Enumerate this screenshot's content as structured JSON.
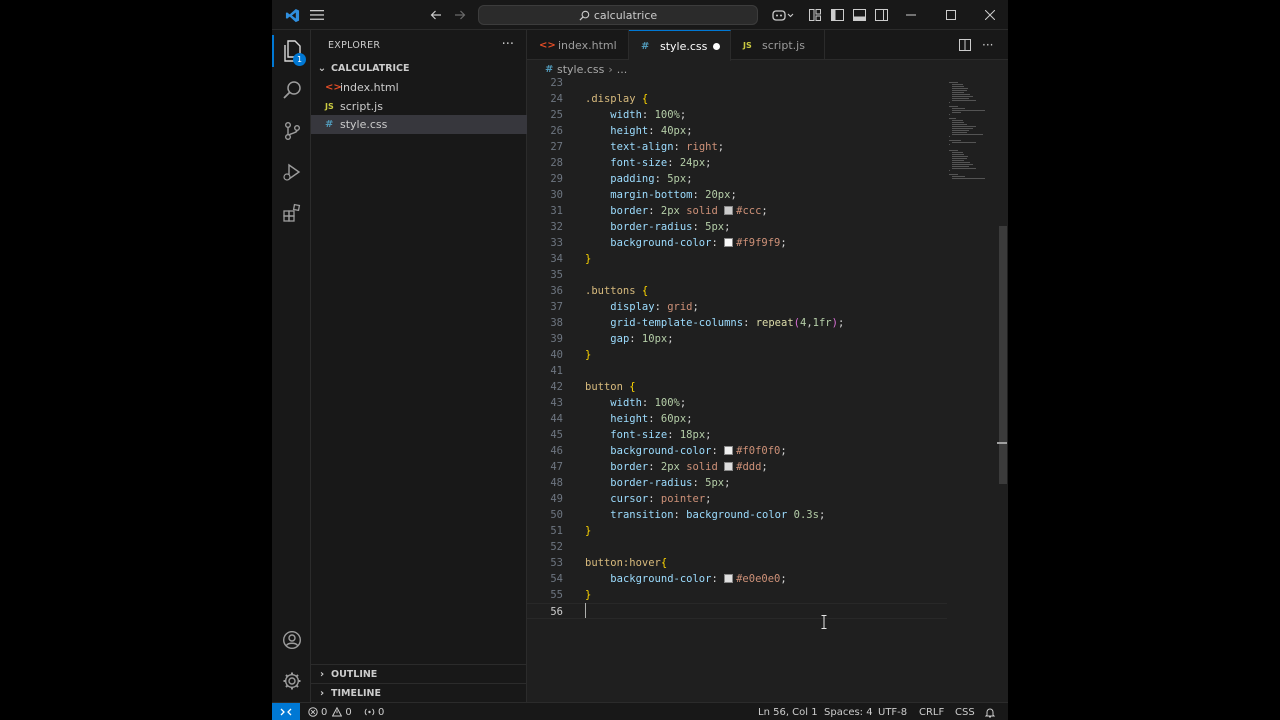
{
  "titlebar": {
    "search_text": "calculatrice"
  },
  "activity": {
    "explorer_badge": "1"
  },
  "sidebar": {
    "header": "EXPLORER",
    "folder": "CALCULATRICE",
    "files": [
      {
        "name": "index.html",
        "type": "html",
        "icon": "<>"
      },
      {
        "name": "script.js",
        "type": "js",
        "icon": "JS"
      },
      {
        "name": "style.css",
        "type": "css",
        "icon": "#"
      }
    ],
    "outline": "OUTLINE",
    "timeline": "TIMELINE"
  },
  "tabs": [
    {
      "label": "index.html",
      "icon": "<>"
    },
    {
      "label": "style.css",
      "icon": "#"
    },
    {
      "label": "script.js",
      "icon": "JS"
    }
  ],
  "breadcrumb": {
    "file": "style.css",
    "icon": "#",
    "more": "..."
  },
  "code": {
    "lines": [
      {
        "n": "23",
        "t": ""
      },
      {
        "n": "24",
        "t": ".display {"
      },
      {
        "n": "25",
        "t": "    width: 100%;"
      },
      {
        "n": "26",
        "t": "    height: 40px;"
      },
      {
        "n": "27",
        "t": "    text-align: right;"
      },
      {
        "n": "28",
        "t": "    font-size: 24px;"
      },
      {
        "n": "29",
        "t": "    padding: 5px;"
      },
      {
        "n": "30",
        "t": "    margin-bottom: 20px;"
      },
      {
        "n": "31",
        "t": "    border: 2px solid #ccc;"
      },
      {
        "n": "32",
        "t": "    border-radius: 5px;"
      },
      {
        "n": "33",
        "t": "    background-color: #f9f9f9;"
      },
      {
        "n": "34",
        "t": "}"
      },
      {
        "n": "35",
        "t": ""
      },
      {
        "n": "36",
        "t": ".buttons {"
      },
      {
        "n": "37",
        "t": "    display: grid;"
      },
      {
        "n": "38",
        "t": "    grid-template-columns: repeat(4,1fr);"
      },
      {
        "n": "39",
        "t": "    gap: 10px;"
      },
      {
        "n": "40",
        "t": "}"
      },
      {
        "n": "41",
        "t": ""
      },
      {
        "n": "42",
        "t": "button {"
      },
      {
        "n": "43",
        "t": "    width: 100%;"
      },
      {
        "n": "44",
        "t": "    height: 60px;"
      },
      {
        "n": "45",
        "t": "    font-size: 18px;"
      },
      {
        "n": "46",
        "t": "    background-color: #f0f0f0;"
      },
      {
        "n": "47",
        "t": "    border: 2px solid #ddd;"
      },
      {
        "n": "48",
        "t": "    border-radius: 5px;"
      },
      {
        "n": "49",
        "t": "    cursor: pointer;"
      },
      {
        "n": "50",
        "t": "    transition: background-color 0.3s;"
      },
      {
        "n": "51",
        "t": "}"
      },
      {
        "n": "52",
        "t": ""
      },
      {
        "n": "53",
        "t": "button:hover{"
      },
      {
        "n": "54",
        "t": "    background-color: #e0e0e0;"
      },
      {
        "n": "55",
        "t": "}"
      },
      {
        "n": "56",
        "t": ""
      }
    ],
    "current_line": "56"
  },
  "statusbar": {
    "errors": "0",
    "warnings": "0",
    "ports": "0",
    "position": "Ln 56, Col 1",
    "spaces": "Spaces: 4",
    "encoding": "UTF-8",
    "eol": "CRLF",
    "language": "CSS"
  },
  "colors": {
    "accent": "#0078d4",
    "background": "#1f1f1f",
    "chrome": "#181818",
    "selector": "#d7ba7d",
    "property": "#9cdcfe",
    "number": "#b5cea8",
    "keyword": "#ce9178"
  }
}
